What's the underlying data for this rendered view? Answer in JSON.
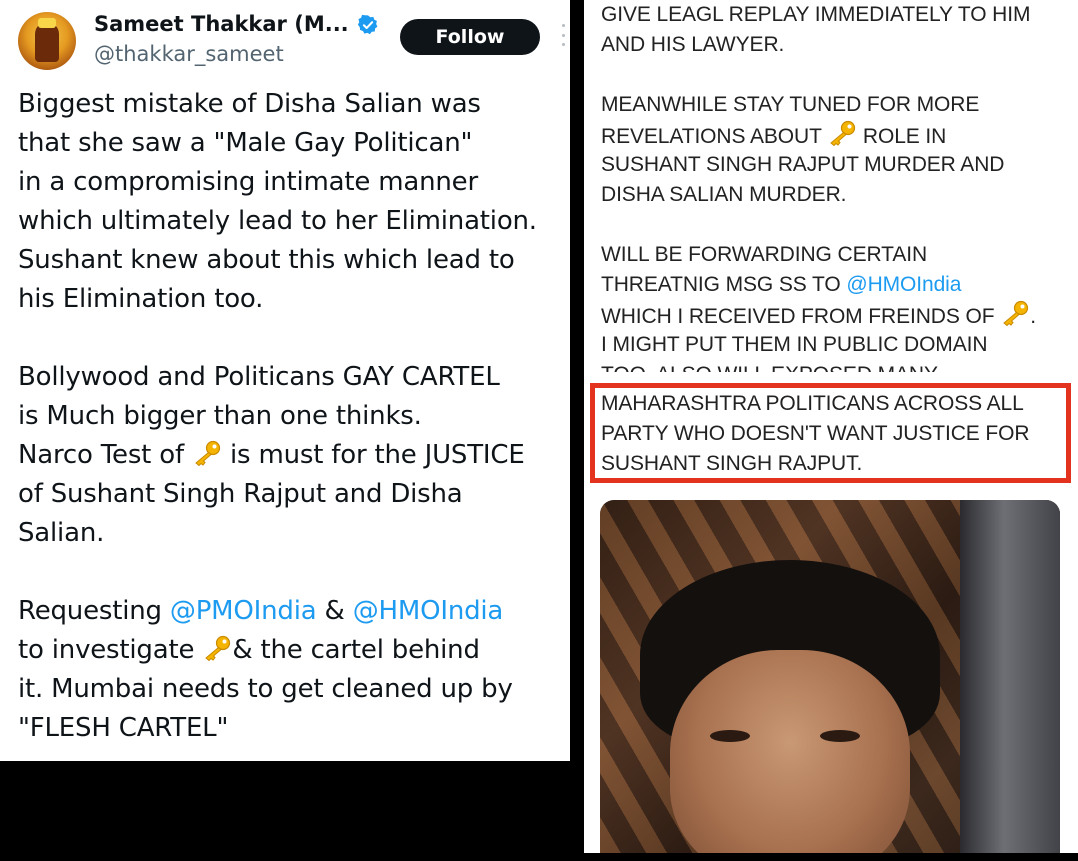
{
  "tweet": {
    "display_name": "Sameet Thakkar (M...",
    "handle": "@thakkar_sameet",
    "follow_label": "Follow",
    "verified": true,
    "body_lines": [
      [
        {
          "t": "Biggest mistake of Disha Salian was"
        }
      ],
      [
        {
          "t": "that she saw a \"Male Gay Politican\""
        }
      ],
      [
        {
          "t": "in a compromising intimate manner"
        }
      ],
      [
        {
          "t": "which ultimately lead to her Elimination."
        }
      ],
      [
        {
          "t": "Sushant knew about this which lead to"
        }
      ],
      [
        {
          "t": "his Elimination too."
        }
      ],
      [],
      [
        {
          "t": "Bollywood and Politicans GAY CARTEL"
        }
      ],
      [
        {
          "t": "is Much bigger than one thinks."
        }
      ],
      [
        {
          "t": "Narco Test of "
        },
        {
          "icon": "key-emoji"
        },
        {
          "t": " is must for the JUSTICE"
        }
      ],
      [
        {
          "t": "of Sushant Singh Rajput and Disha"
        }
      ],
      [
        {
          "t": "Salian."
        }
      ],
      [],
      [
        {
          "t": "Requesting "
        },
        {
          "m": "@PMOIndia"
        },
        {
          "t": " & "
        },
        {
          "m": "@HMOIndia"
        }
      ],
      [
        {
          "t": "to investigate "
        },
        {
          "icon": "key-emoji"
        },
        {
          "t": "& the cartel behind"
        }
      ],
      [
        {
          "t": "it.  Mumbai needs to get cleaned up by"
        }
      ],
      [
        {
          "t": "\"FLESH CARTEL\""
        }
      ]
    ]
  },
  "screenshot_post": {
    "lines": [
      [
        {
          "t": "GIVE LEAGL REPLAY IMMEDIATELY TO HIM"
        }
      ],
      [
        {
          "t": "AND HIS LAWYER."
        }
      ],
      [],
      [
        {
          "t": "MEANWHILE STAY TUNED FOR MORE"
        }
      ],
      [
        {
          "t": "REVELATIONS ABOUT "
        },
        {
          "icon": "key-emoji"
        },
        {
          "t": " ROLE IN"
        }
      ],
      [
        {
          "t": "SUSHANT SINGH RAJPUT MURDER AND"
        }
      ],
      [
        {
          "t": "DISHA SALIAN MURDER."
        }
      ],
      [],
      [
        {
          "t": "WILL BE FORWARDING CERTAIN"
        }
      ],
      [
        {
          "t": "THREATNIG MSG SS TO "
        },
        {
          "m": "@HMOIndia"
        }
      ],
      [
        {
          "t": "WHICH I RECEIVED FROM FREINDS OF "
        },
        {
          "icon": "key-emoji"
        },
        {
          "t": "."
        }
      ],
      [
        {
          "t": "I MIGHT PUT THEM IN PUBLIC DOMAIN"
        }
      ],
      [
        {
          "t": "TOO. ALSO WILL EXPOSED MANY",
          "clipped": true
        }
      ]
    ],
    "highlighted_lines": [
      "MAHARASHTRA POLITICANS ACROSS ALL",
      "PARTY WHO DOESN'T WANT JUSTICE FOR",
      "SUSHANT SINGH RAJPUT."
    ],
    "highlight_color": "#e3331e",
    "mention_color": "#1d9bf0"
  }
}
